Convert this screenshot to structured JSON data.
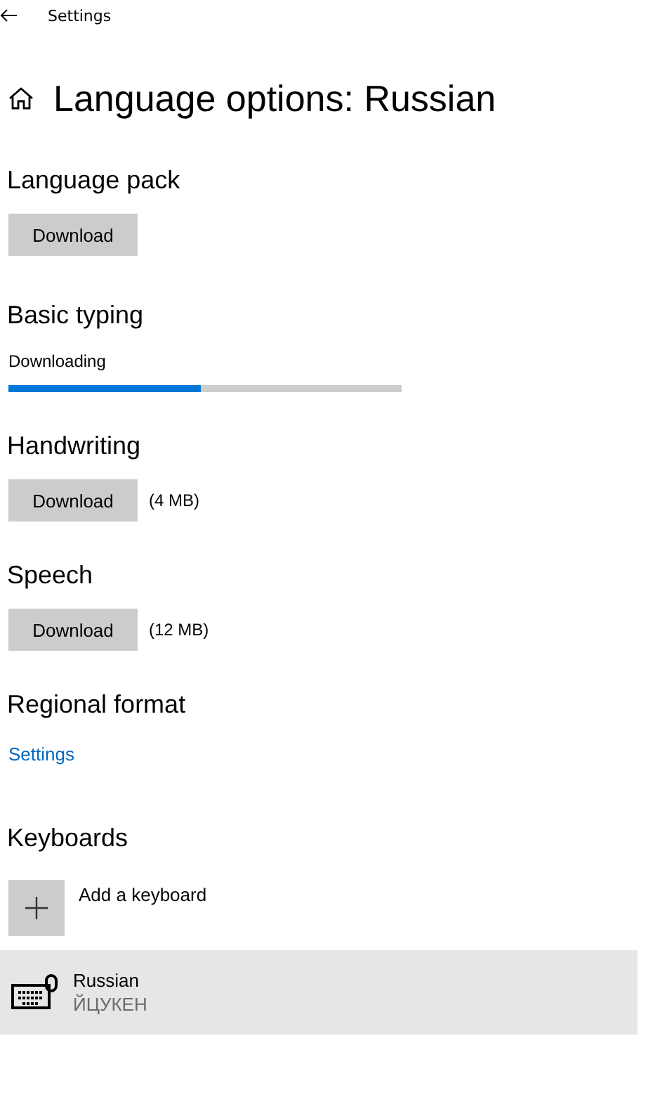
{
  "window": {
    "title": "Settings"
  },
  "page_title": "Language options: Russian",
  "sections": [
    {
      "kind": "download",
      "heading": "Language pack",
      "button": "Download"
    },
    {
      "kind": "progress",
      "heading": "Basic typing",
      "status": "Downloading",
      "level": 0.49
    },
    {
      "kind": "download",
      "heading": "Handwriting",
      "button": "Download",
      "size": "(4 MB)"
    },
    {
      "kind": "download",
      "heading": "Speech",
      "button": "Download",
      "size": "(12 MB)"
    },
    {
      "kind": "link",
      "heading": "Regional format",
      "link": "Settings"
    }
  ],
  "keyboards": {
    "heading": "Keyboards",
    "add_label": "Add a keyboard",
    "items": [
      {
        "name": "Russian",
        "layout": "ЙЦУКЕН",
        "selected": true
      }
    ]
  }
}
